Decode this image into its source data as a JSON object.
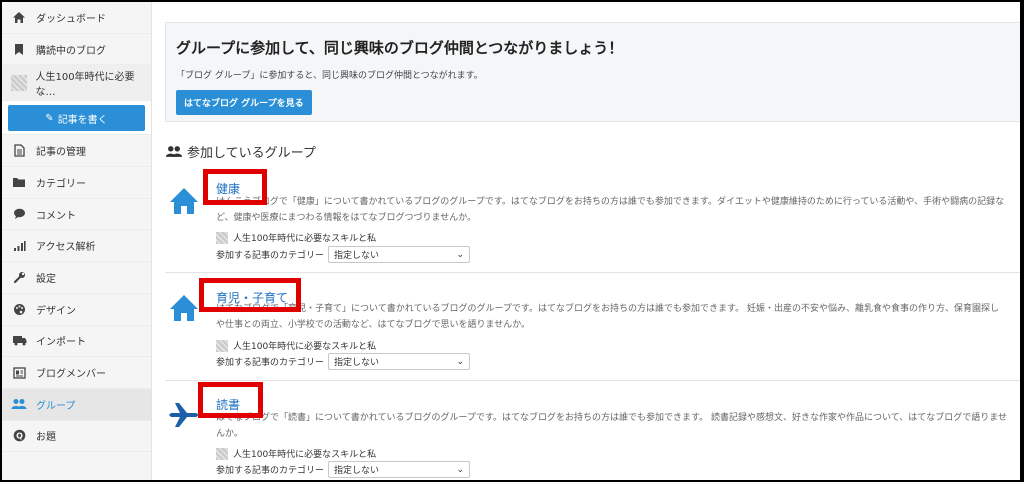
{
  "sidebar": {
    "dashboard": "ダッシュボード",
    "subscribed": "購読中のブログ",
    "blog_name": "人生100年時代に必要な…",
    "write": "記事を書く",
    "items": [
      {
        "label": "記事の管理",
        "icon": "document-icon"
      },
      {
        "label": "カテゴリー",
        "icon": "folder-icon"
      },
      {
        "label": "コメント",
        "icon": "comment-icon"
      },
      {
        "label": "アクセス解析",
        "icon": "bar-chart-icon"
      },
      {
        "label": "設定",
        "icon": "wrench-icon"
      },
      {
        "label": "デザイン",
        "icon": "palette-icon"
      },
      {
        "label": "インポート",
        "icon": "truck-icon"
      },
      {
        "label": "ブログメンバー",
        "icon": "member-card-icon"
      },
      {
        "label": "グループ",
        "icon": "group-icon"
      },
      {
        "label": "お題",
        "icon": "question-icon"
      }
    ],
    "active_color": "#2a8fd6"
  },
  "banner": {
    "title": "グループに参加して、同じ興味のブログ仲間とつながりましょう！",
    "text": "「ブログ グループ」に参加すると、同じ興味のブログ仲間とつながれます。",
    "button": "はてなブログ グループを見る"
  },
  "section_title": "参加しているグループ",
  "groups": [
    {
      "title": "健康",
      "icon": "house-icon",
      "desc1": "けんこうブログで「健康」について書かれているブログのグループです。はてなブログをお持ちの方は誰でも参加できます。ダイエットや健康維持のために行っている活動や、手術や闘病の記録な",
      "desc2": "ど、健康や医療にまつわる情報をはてなブログつづりませんか。",
      "joined_blog": "人生100年時代に必要なスキルと私",
      "category_label": "参加する記事のカテゴリー",
      "category_value": "指定しない"
    },
    {
      "title": "育児・子育て",
      "icon": "house-icon",
      "desc1": "はてなブログで「育児・子育て」について書かれているブログのグループです。はてなブログをお持ちの方は誰でも参加できます。 妊娠・出産の不安や悩み、離乳食や食事の作り方、保育園探し",
      "desc2": "や仕事との両立、小学校での活動など、はてなブログで思いを語りませんか。",
      "joined_blog": "人生100年時代に必要なスキルと私",
      "category_label": "参加する記事のカテゴリー",
      "category_value": "指定しない"
    },
    {
      "title": "読書",
      "icon": "airplane-icon",
      "desc1": "はてなブログで「読書」について書かれているブログのグループです。はてなブログをお持ちの方は誰でも参加できます。 読書記録や感想文、好きな作家や作品について、はてなブログで語りませ",
      "desc2": "んか。",
      "joined_blog": "人生100年時代に必要なスキルと私",
      "category_label": "参加する記事のカテゴリー",
      "category_value": "指定しない"
    }
  ]
}
